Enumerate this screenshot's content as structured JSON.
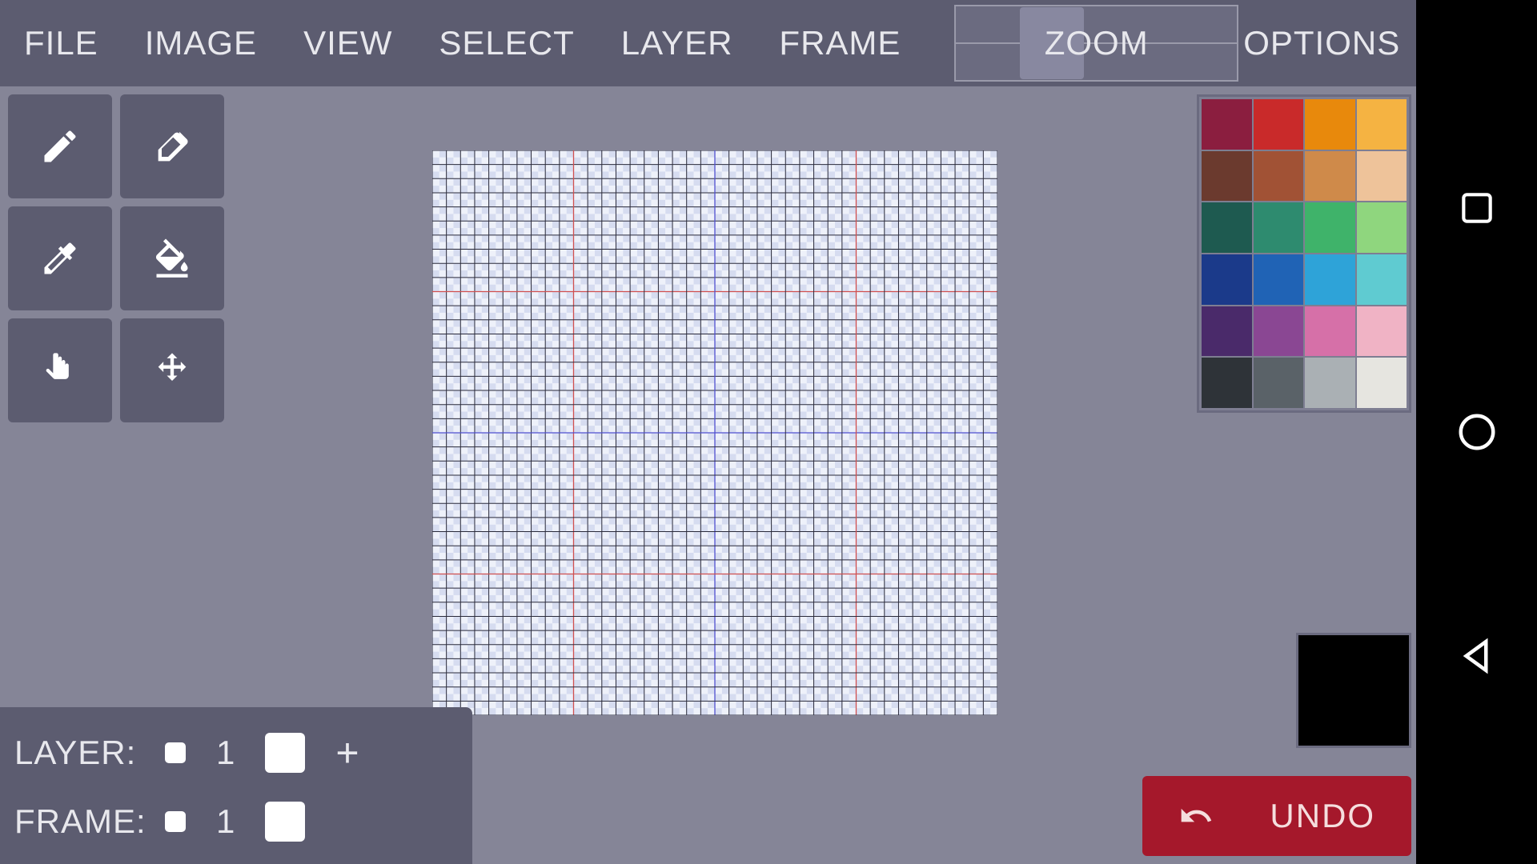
{
  "menu": {
    "file": "FILE",
    "image": "IMAGE",
    "view": "VIEW",
    "select": "SELECT",
    "layer": "LAYER",
    "frame": "FRAME",
    "zoom": "ZOOM",
    "options": "OPTIONS"
  },
  "tools": {
    "pencil": "pencil",
    "eraser": "eraser",
    "eyedropper": "eyedropper",
    "bucket": "bucket",
    "select": "select",
    "move": "move"
  },
  "palette": [
    "#8b1e3f",
    "#c92a2a",
    "#e8890c",
    "#f5b342",
    "#6b3a2e",
    "#a15235",
    "#cf8a4a",
    "#eec39a",
    "#1e5a50",
    "#2e8b6f",
    "#3fb36a",
    "#8fd67e",
    "#1b3a8a",
    "#2063b5",
    "#2ea3d8",
    "#5fcbd1",
    "#4a2a6a",
    "#8a4793",
    "#d670a8",
    "#f0b3c5",
    "#2e3338",
    "#5a6268",
    "#aab0b4",
    "#e6e5e0"
  ],
  "current_color": "#000000",
  "undo_label": "UNDO",
  "bottom": {
    "layer_label": "LAYER:",
    "layer_num": "1",
    "frame_label": "FRAME:",
    "frame_num": "1",
    "plus": "+"
  },
  "canvas": {
    "grid_cells": 40,
    "major_every": 10,
    "mid_color": "#5050d0",
    "major_color": "#d05050"
  }
}
